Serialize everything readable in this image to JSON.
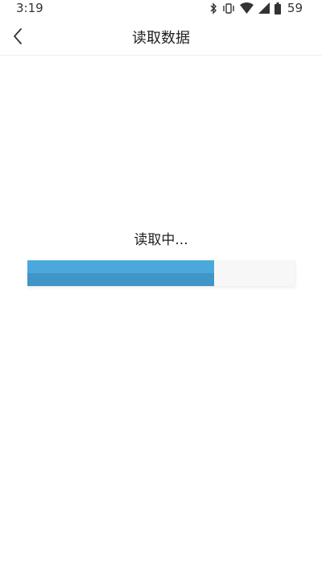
{
  "status_bar": {
    "time": "3:19",
    "battery": "59",
    "icons": [
      "bluetooth-icon",
      "vibrate-icon",
      "wifi-icon",
      "signal-icon",
      "battery-icon"
    ]
  },
  "header": {
    "title": "读取数据",
    "back_icon": "chevron-left-icon"
  },
  "loading": {
    "text": "读取中...",
    "progress": 0.7,
    "fill_color": "#4aa8db",
    "track_color": "#f7f7f7"
  }
}
